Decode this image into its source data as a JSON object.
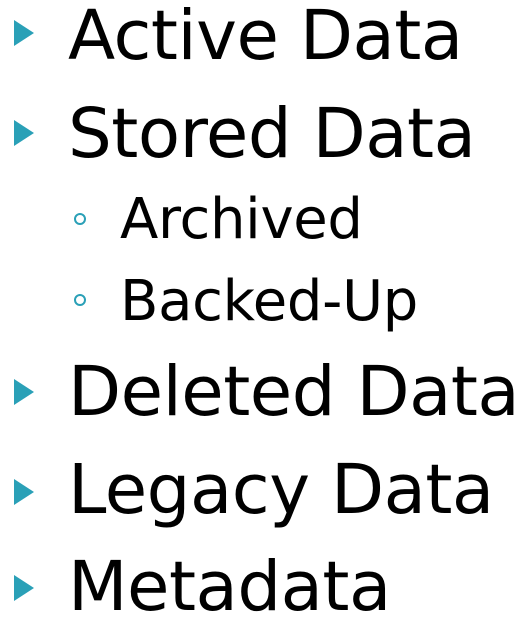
{
  "bullets": [
    {
      "level": 1,
      "label": "Active Data"
    },
    {
      "level": 1,
      "label": "Stored Data"
    },
    {
      "level": 2,
      "label": "Archived"
    },
    {
      "level": 2,
      "label": "Backed-Up"
    },
    {
      "level": 1,
      "label": "Deleted Data"
    },
    {
      "level": 1,
      "label": "Legacy Data"
    },
    {
      "level": 1,
      "label": "Metadata"
    }
  ],
  "colors": {
    "bullet_accent": "#2aa0b7",
    "text": "#000000",
    "background": "#ffffff"
  },
  "icons": {
    "level1_bullet": "triangle-bullet-icon",
    "level2_bullet": "hollow-circle-bullet-icon"
  }
}
